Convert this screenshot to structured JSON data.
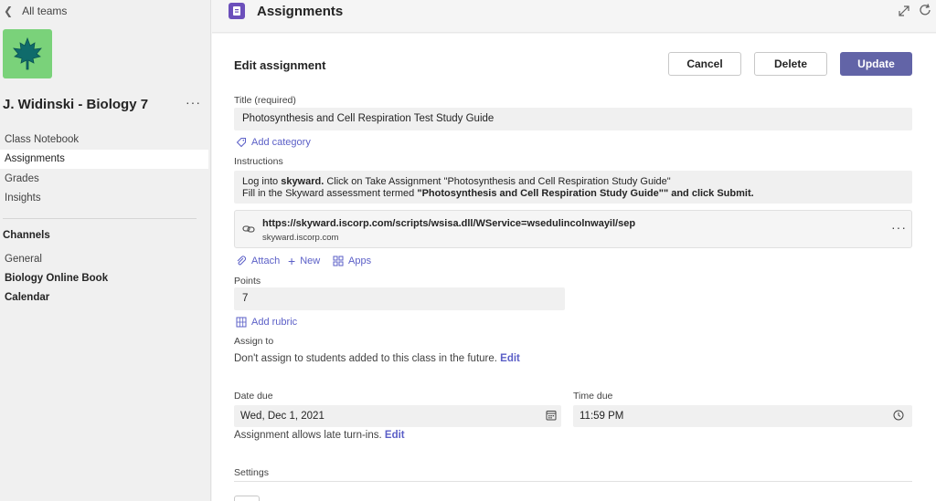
{
  "sidebar": {
    "back_label": "All teams",
    "team_name": "J. Widinski - Biology 7",
    "more_label": "···",
    "nav": [
      "Class Notebook",
      "Assignments",
      "Grades",
      "Insights"
    ],
    "active_nav": "Assignments",
    "channels_heading": "Channels",
    "channels": [
      {
        "label": "General",
        "bold": false
      },
      {
        "label": "Biology Online Book",
        "bold": true
      },
      {
        "label": "Calendar",
        "bold": true
      }
    ],
    "avatar_color": "#7ad27a"
  },
  "header": {
    "app_title": "Assignments",
    "icons": [
      "assignments-app-icon",
      "expand-icon",
      "refresh-icon"
    ]
  },
  "form": {
    "heading": "Edit assignment",
    "buttons": {
      "cancel": "Cancel",
      "delete": "Delete",
      "update": "Update"
    },
    "title_label": "Title (required)",
    "title_value": "Photosynthesis and Cell Respiration Test Study Guide",
    "add_category": "Add category",
    "instructions_label": "Instructions",
    "instructions": {
      "line1_pre": "Log into ",
      "line1_bold": "skyward.",
      "line1_post": " Click on Take Assignment \"Photosynthesis and Cell Respiration Study Guide\"",
      "line2_pre": "Fill in the Skyward assessment termed ",
      "line2_bold": "\"Photosynthesis and Cell Respiration Study Guide\"\" and click Submit."
    },
    "link": {
      "url": "https://skyward.iscorp.com/scripts/wsisa.dll/WService=wsedulincolnwayil/sep",
      "domain": "skyward.iscorp.com",
      "more": "···"
    },
    "resource_actions": [
      "Attach",
      "New",
      "Apps"
    ],
    "points_label": "Points",
    "points_value": "7",
    "add_rubric": "Add rubric",
    "assign_label": "Assign to",
    "assign_text": "Don't assign to students added to this class in the future.",
    "edit_label": "Edit",
    "date_due_label": "Date due",
    "date_due_value": "Wed, Dec 1, 2021",
    "time_due_label": "Time due",
    "time_due_value": "11:59 PM",
    "late_text": "Assignment allows late turn-ins.",
    "settings_label": "Settings"
  },
  "colors": {
    "accent": "#6264a7",
    "link": "#5b5fc7",
    "app_icon": "#6b4fbb"
  }
}
